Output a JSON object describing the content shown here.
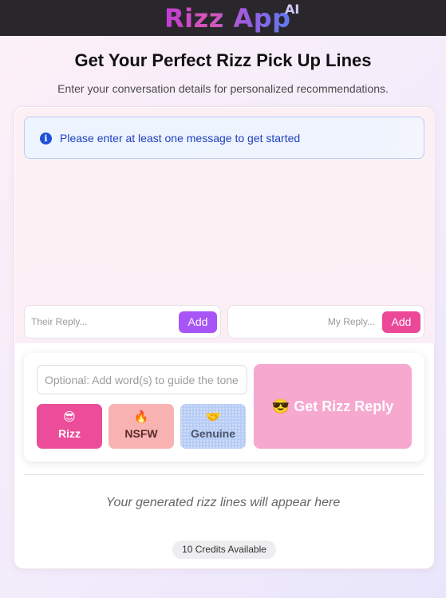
{
  "header": {
    "logo_text": "Rizz App",
    "logo_sup": "AI"
  },
  "hero": {
    "title": "Get Your Perfect Rizz Pick Up Lines",
    "subtitle": "Enter your conversation details for personalized recommendations."
  },
  "alert": {
    "icon": "info-icon",
    "icon_glyph": "i",
    "text": "Please enter at least one message to get started",
    "color": "#1e3fbf"
  },
  "replies": {
    "their": {
      "placeholder": "Their Reply...",
      "value": "",
      "add_label": "Add",
      "accent": "#a855f7"
    },
    "mine": {
      "placeholder": "My Reply...",
      "value": "",
      "add_label": "Add",
      "accent": "#ec4899"
    }
  },
  "controls": {
    "tone_placeholder": "Optional: Add word(s) to guide the tone",
    "tone_value": "",
    "modes": [
      {
        "emoji": "😎",
        "label": "Rizz",
        "selected": true,
        "color": "#ec4d9a"
      },
      {
        "emoji": "🔥",
        "label": "NSFW",
        "selected": false,
        "color": "#f9b2b2"
      },
      {
        "emoji": "🤝",
        "label": "Genuine",
        "selected": false,
        "color": "#b8cdf5"
      }
    ],
    "submit_label": "😎 Get Rizz Reply"
  },
  "output": {
    "placeholder": "Your generated rizz lines will appear here"
  },
  "credits": {
    "label": "10 Credits Available"
  }
}
